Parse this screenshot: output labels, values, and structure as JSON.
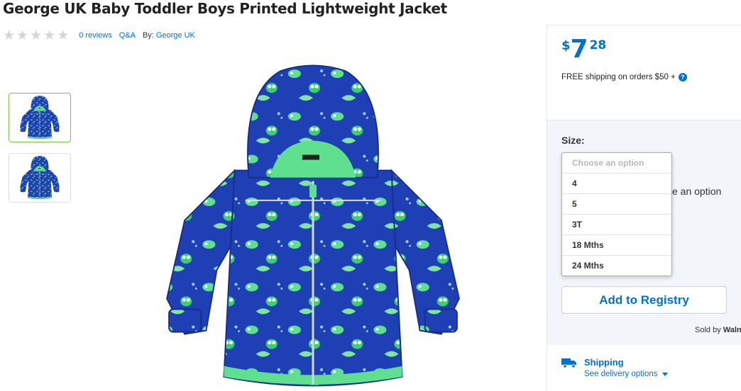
{
  "product": {
    "title": "George UK Baby Toddler Boys Printed Lightweight Jacket",
    "rating_stars": 5,
    "reviews_link": "0 reviews",
    "qa_link": "Q&A",
    "by_label": "By:",
    "brand_link": "George UK"
  },
  "thumbnails": [
    {
      "name": "front view",
      "selected": true
    },
    {
      "name": "back view",
      "selected": false
    }
  ],
  "price": {
    "currency": "$",
    "dollars": "7",
    "cents": "28",
    "shipping_note": "FREE shipping on orders $50 +",
    "help_icon": "?"
  },
  "options": {
    "size_label": "Size:",
    "behind_text": "e an option",
    "dropdown": {
      "placeholder": "Choose an option",
      "items": [
        "4",
        "5",
        "3T",
        "18 Mths",
        "24 Mths"
      ]
    },
    "registry_button": "Add to Registry",
    "sold_by": "Sold by",
    "sold_by_name": "Waln"
  },
  "shipping": {
    "title": "Shipping",
    "link": "See delivery options"
  },
  "colors": {
    "brand_blue": "#0071ce",
    "jacket_blue": "#1f3fb5",
    "jacket_green": "#5fe08f"
  }
}
